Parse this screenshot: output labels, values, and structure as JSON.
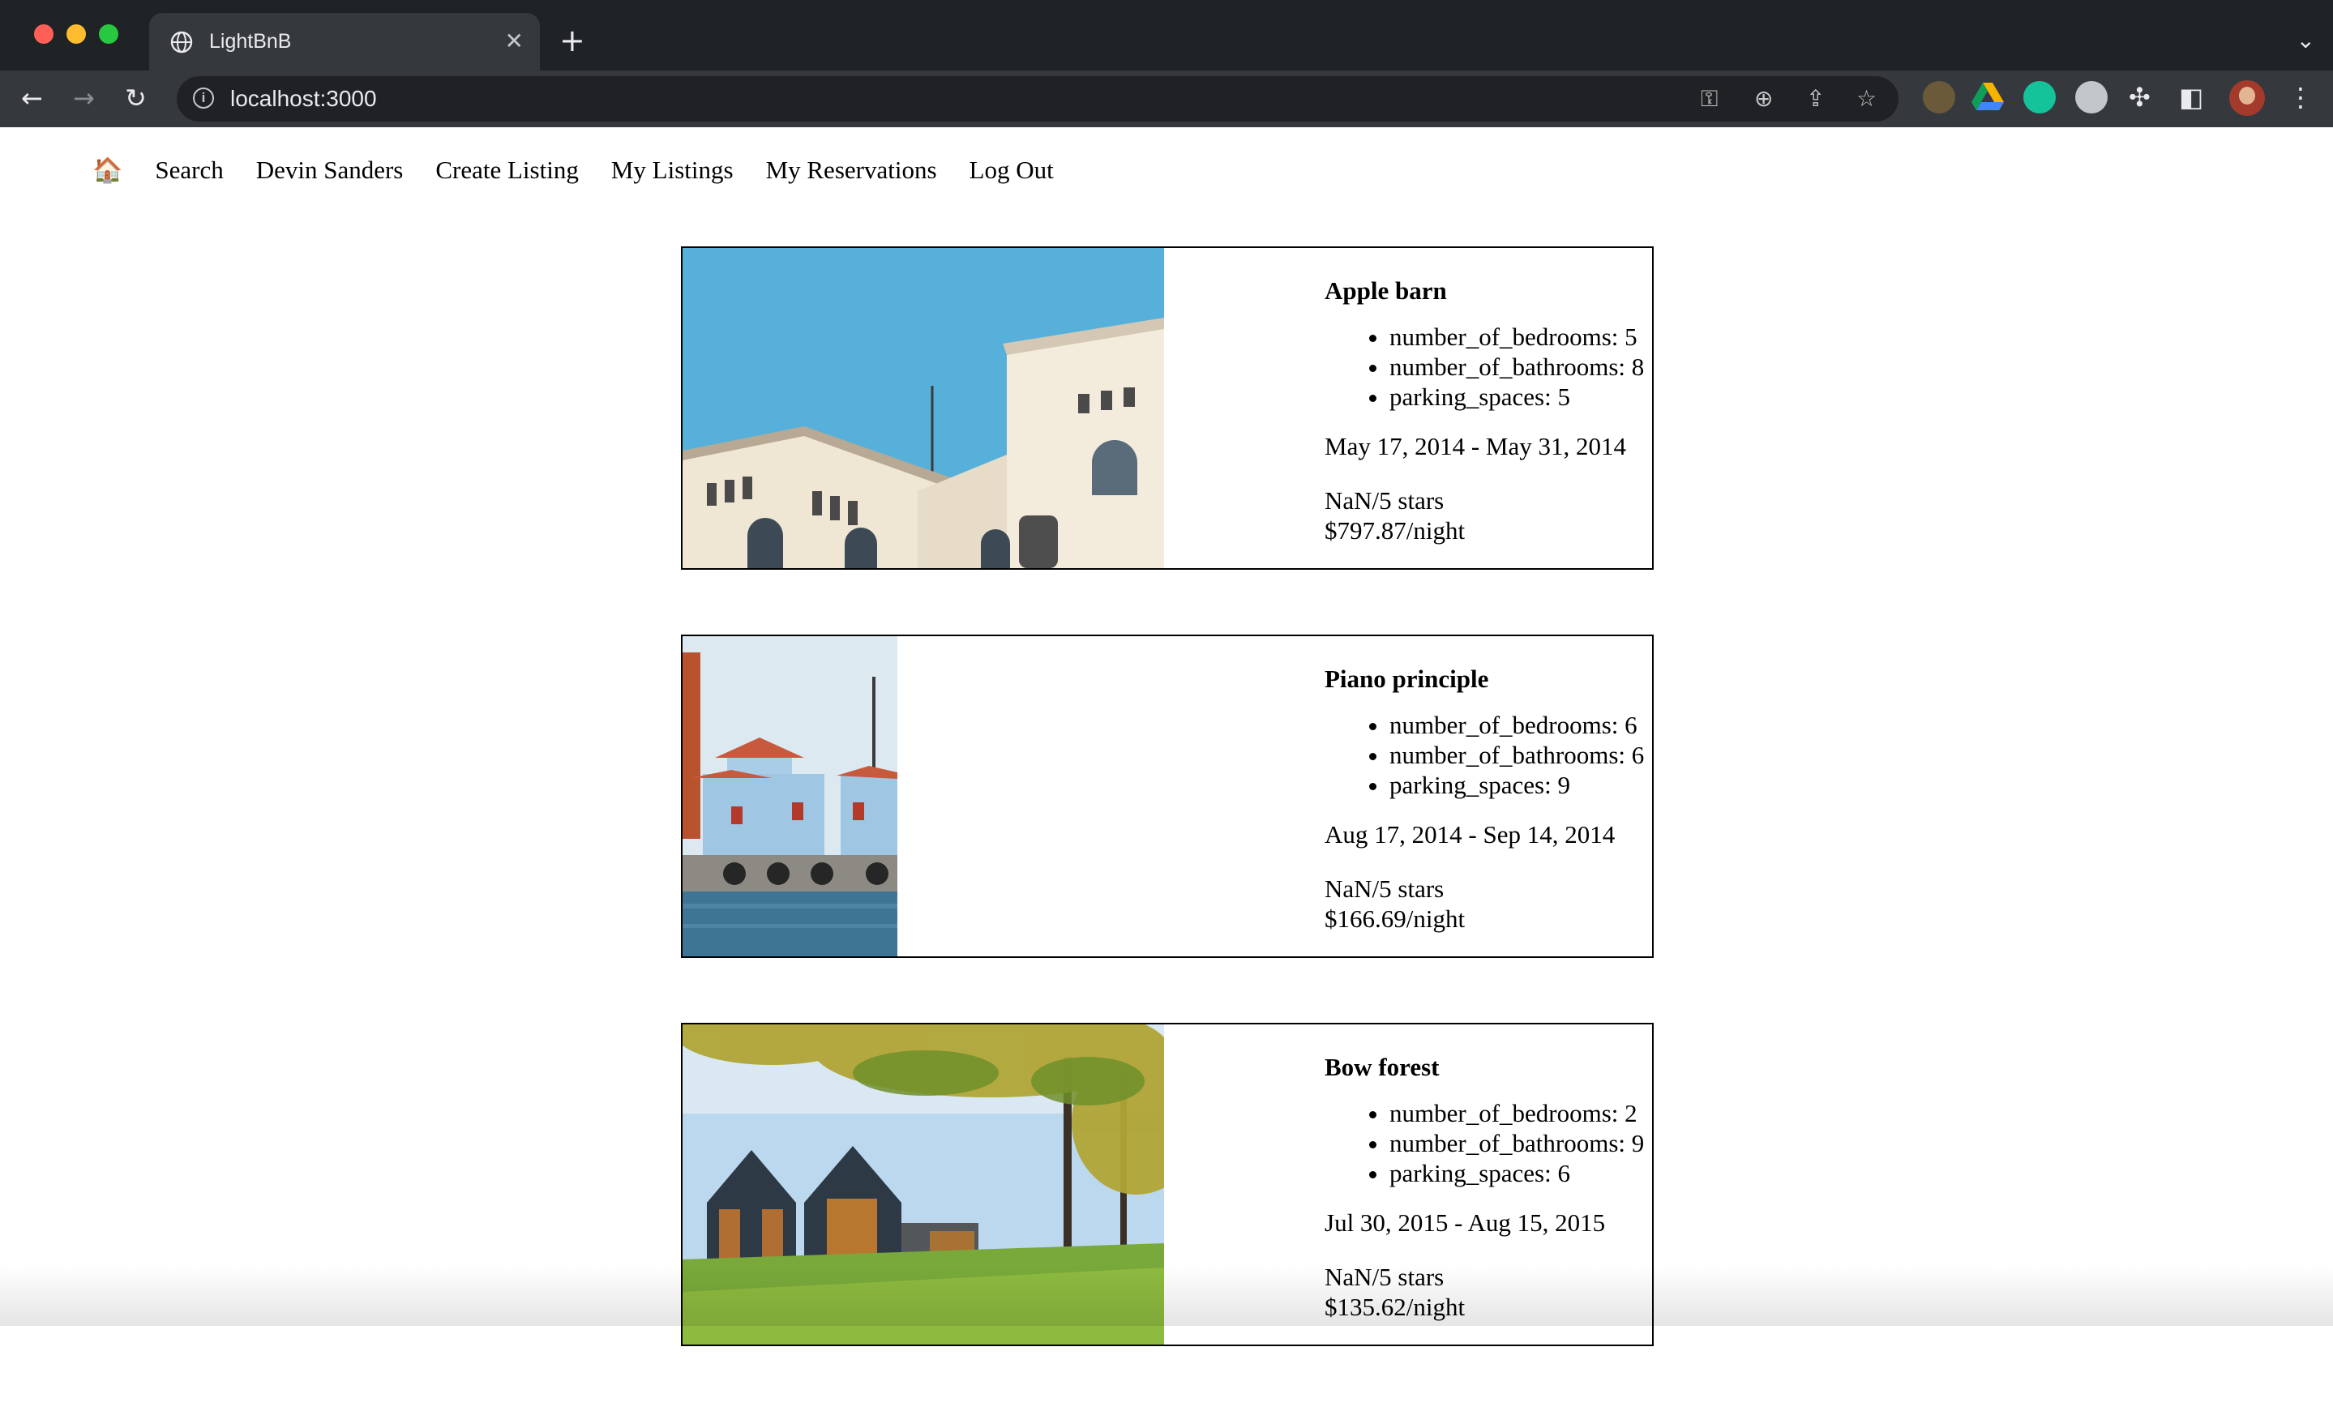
{
  "browser": {
    "tab_title": "LightBnB",
    "url": "localhost:3000",
    "new_tab": "+",
    "close": "✕"
  },
  "nav": {
    "home_icon": "🏠",
    "search": "Search",
    "user": "Devin Sanders",
    "create_listing": "Create Listing",
    "my_listings": "My Listings",
    "my_reservations": "My Reservations",
    "log_out": "Log Out"
  },
  "reservations": [
    {
      "title": "Apple barn",
      "bedrooms": "number_of_bedrooms: 5",
      "bathrooms": "number_of_bathrooms: 8",
      "parking": "parking_spaces: 5",
      "dates": "May 17, 2014 - May 31, 2014",
      "rating": "NaN/5 stars",
      "price": "$797.87/night"
    },
    {
      "title": "Piano principle",
      "bedrooms": "number_of_bedrooms: 6",
      "bathrooms": "number_of_bathrooms: 6",
      "parking": "parking_spaces: 9",
      "dates": "Aug 17, 2014 - Sep 14, 2014",
      "rating": "NaN/5 stars",
      "price": "$166.69/night"
    },
    {
      "title": "Bow forest",
      "bedrooms": "number_of_bedrooms: 2",
      "bathrooms": "number_of_bathrooms: 9",
      "parking": "parking_spaces: 6",
      "dates": "Jul 30, 2015 - Aug 15, 2015",
      "rating": "NaN/5 stars",
      "price": "$135.62/night"
    }
  ],
  "icons": {
    "back": "back-arrow-icon",
    "forward": "forward-arrow-icon",
    "reload": "reload-icon",
    "key": "key-icon",
    "zoom": "zoom-icon",
    "share": "share-icon",
    "bookmark": "star-icon",
    "extensions": "puzzle-icon",
    "side_panel": "side-panel-icon",
    "menu": "kebab-menu-icon"
  }
}
